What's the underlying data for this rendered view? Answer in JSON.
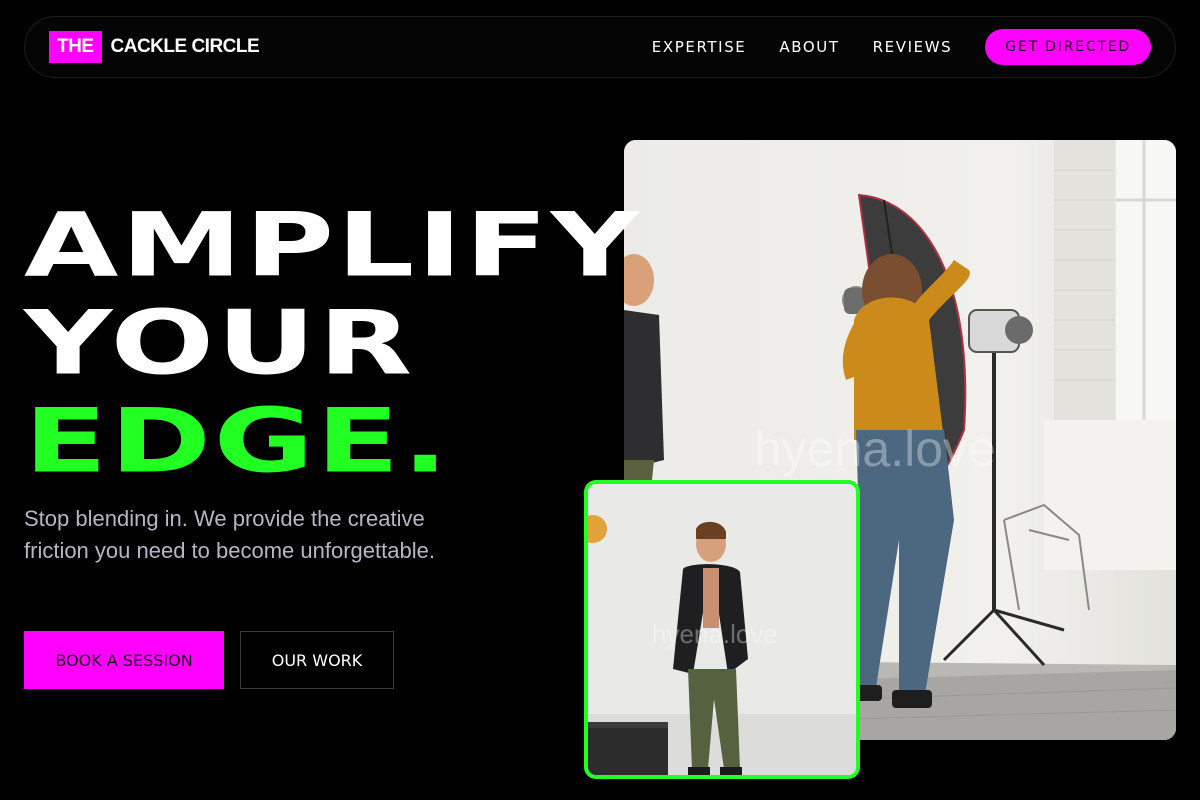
{
  "nav": {
    "logo_prefix": "THE",
    "logo_name": "CACKLE CIRCLE",
    "links": [
      {
        "label": "EXPERTISE"
      },
      {
        "label": "ABOUT"
      },
      {
        "label": "REVIEWS"
      }
    ],
    "cta_label": "GET DIRECTED"
  },
  "hero": {
    "line1": "AMPLIFY",
    "line2": "YOUR",
    "line3": "EDGE.",
    "subtext": "Stop blending in. We provide the creative friction you need to become unforgettable.",
    "primary_button": "BOOK A SESSION",
    "secondary_button": "OUR WORK"
  },
  "images": {
    "main_watermark": "hyena.love",
    "inset_watermark": "hyena.love"
  },
  "colors": {
    "accent_magenta": "#ff00ff",
    "accent_green": "#22ff22",
    "background": "#000000"
  }
}
